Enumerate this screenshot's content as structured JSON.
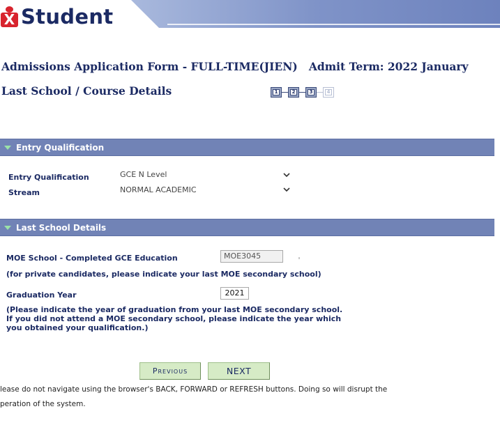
{
  "header": {
    "logo_text": "Student"
  },
  "form_title": "Admissions Application Form - FULL-TIME(JIEN)   Admit Term: 2022 January",
  "page_title": "Last School / Course Details",
  "steps": [
    {
      "label": "1",
      "state": "active"
    },
    {
      "label": "2",
      "state": "active"
    },
    {
      "label": "3",
      "state": "active"
    },
    {
      "label": "4",
      "state": "inactive"
    }
  ],
  "entry_section": {
    "title": "Entry Qualification",
    "qualification_label": "Entry Qualification",
    "qualification_value": "GCE N Level",
    "stream_label": "Stream",
    "stream_value": "NORMAL ACADEMIC"
  },
  "school_section": {
    "title": "Last School Details",
    "moe_school_label": "MOE School - Completed GCE Education",
    "moe_school_value": "MOE3045",
    "moe_school_note": "(for private candidates, please indicate your last MOE secondary school)",
    "grad_year_label": "Graduation Year",
    "grad_year_value": "2021",
    "grad_note_lines": [
      "(Please indicate the year of graduation from your last MOE secondary school.",
      "If you did not attend a MOE secondary school, please indicate the year which",
      "you obtained your qualification.)"
    ]
  },
  "buttons": {
    "previous": "Previous",
    "next": "NEXT"
  },
  "footer": {
    "line1": "lease do not navigate using the browser's BACK, FORWARD or REFRESH buttons. Doing so will disrupt the",
    "line2": "peration of the system."
  },
  "colors": {
    "brand_navy": "#1b2a63",
    "logo_red": "#d8242e",
    "section_bar": "#7183b6",
    "button_green": "#d6ebc6"
  }
}
